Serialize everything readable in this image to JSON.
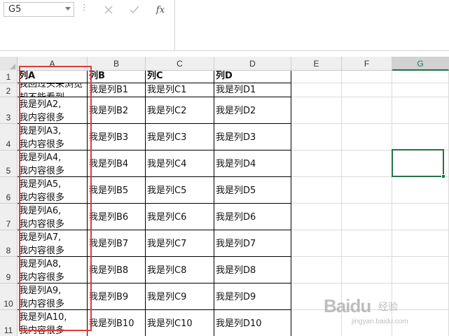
{
  "formula_bar": {
    "name_box": "G5",
    "buttons": {
      "cancel_icon": "close-icon",
      "enter_icon": "check-icon",
      "insert_function_label": "fx"
    },
    "formula_value": ""
  },
  "columns": [
    "A",
    "B",
    "C",
    "D",
    "E",
    "F",
    "G"
  ],
  "selected_column": "G",
  "selected_cell": "G5",
  "rows": [
    "1",
    "2",
    "3",
    "4",
    "5",
    "6",
    "7",
    "8",
    "9",
    "10",
    "11"
  ],
  "table": {
    "header": [
      "列A",
      "列B",
      "列C",
      "列D"
    ],
    "row2_a_partial": "我回过头来浏览却不能看到",
    "col_a_lines": [
      [
        "我是列A2,",
        "我内容很多"
      ],
      [
        "我是列A3,",
        "我内容很多"
      ],
      [
        "我是列A4,",
        "我内容很多"
      ],
      [
        "我是列A5,",
        "我内容很多"
      ],
      [
        "我是列A6,",
        "我内容很多"
      ],
      [
        "我是列A7,",
        "我内容很多"
      ],
      [
        "我是列A8,",
        "我内容很多"
      ],
      [
        "我是列A9,",
        "我内容很多"
      ],
      [
        "我是列A10,",
        "我内容很多"
      ]
    ],
    "col_b": [
      "我是列B1",
      "我是列B2",
      "我是列B3",
      "我是列B4",
      "我是列B5",
      "我是列B6",
      "我是列B7",
      "我是列B8",
      "我是列B9",
      "我是列B10"
    ],
    "col_c": [
      "我是列C1",
      "我是列C2",
      "我是列C3",
      "我是列C4",
      "我是列C5",
      "我是列C6",
      "我是列C7",
      "我是列C8",
      "我是列C9",
      "我是列C10"
    ],
    "col_d": [
      "我是列D1",
      "我是列D2",
      "我是列D3",
      "我是列D4",
      "我是列D5",
      "我是列D6",
      "我是列D7",
      "我是列D8",
      "我是列D9",
      "我是列D10"
    ]
  },
  "watermark": {
    "brand": "Baidu",
    "sub": "经验",
    "url": "jingyan.baidu.com"
  },
  "colors": {
    "accent": "#217346",
    "highlight_box": "#e33b3b",
    "header_bg": "#efefef"
  }
}
